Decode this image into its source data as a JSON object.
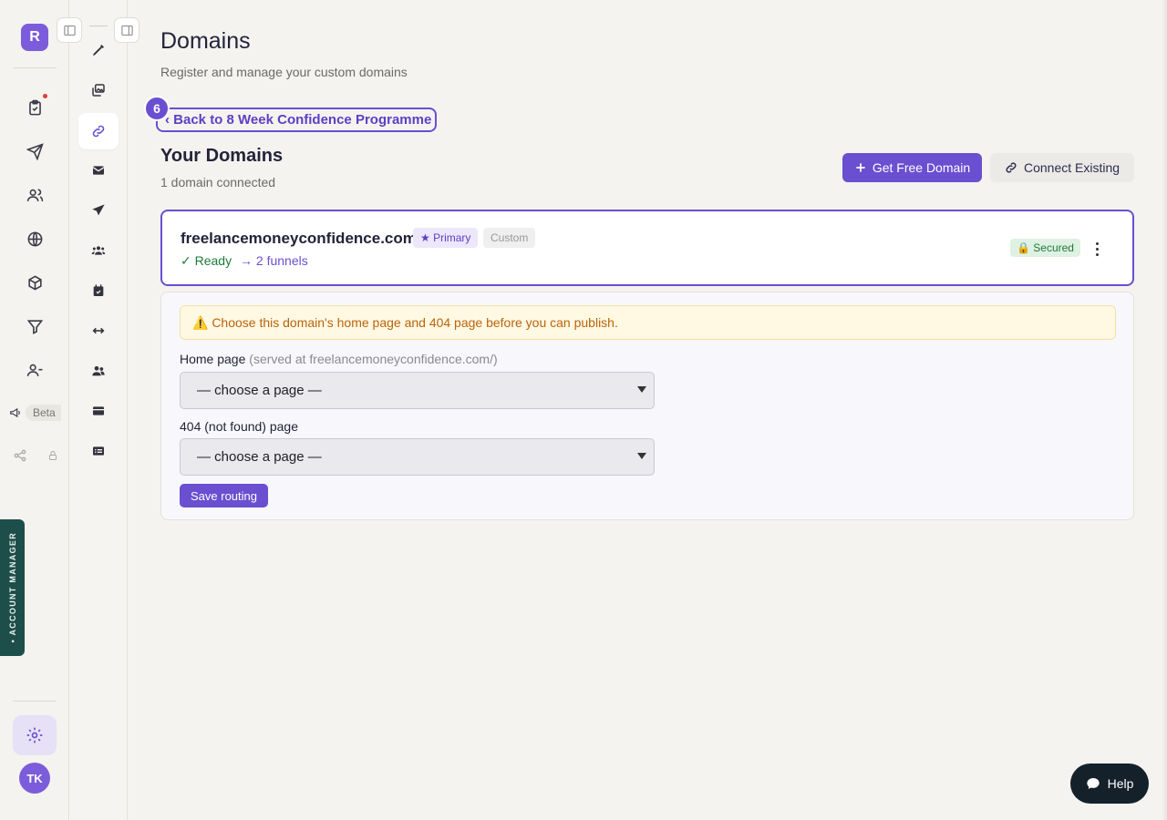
{
  "rail": {
    "logo_letter": "R",
    "beta_label": "Beta",
    "account_manager_label": "• ACCOUNT MANAGER",
    "avatar_initials": "TK"
  },
  "header": {
    "title": "Domains",
    "subtitle": "Register and manage your custom domains"
  },
  "guide": {
    "step_number": "6",
    "back_link_label": "‹ Back to 8 Week Confidence Programme"
  },
  "domains_section": {
    "title": "Your Domains",
    "count_text": "1 domain connected",
    "get_free_label": "Get Free Domain",
    "connect_existing_label": "Connect Existing"
  },
  "domain": {
    "name": "freelancemoneyconfidence.com",
    "primary_tag": "★ Primary",
    "type_tag": "Custom",
    "status": "✓ Ready",
    "funnels": "→ 2 funnels",
    "secured_badge": "🔒 Secured"
  },
  "routing": {
    "warning": "⚠️ Choose this domain's home page and 404 page before you can publish.",
    "home_label": "Home page",
    "home_hint": "(served at freelancemoneyconfidence.com/)",
    "home_value": "— choose a page —",
    "notfound_label": "404 (not found) page",
    "notfound_value": "— choose a page —",
    "save_label": "Save routing"
  },
  "help": {
    "label": "Help"
  },
  "colors": {
    "accent": "#6a4fd0",
    "success": "#1f7a3a",
    "warning": "#b8650c",
    "account_manager_bg": "#1d4e4a"
  }
}
